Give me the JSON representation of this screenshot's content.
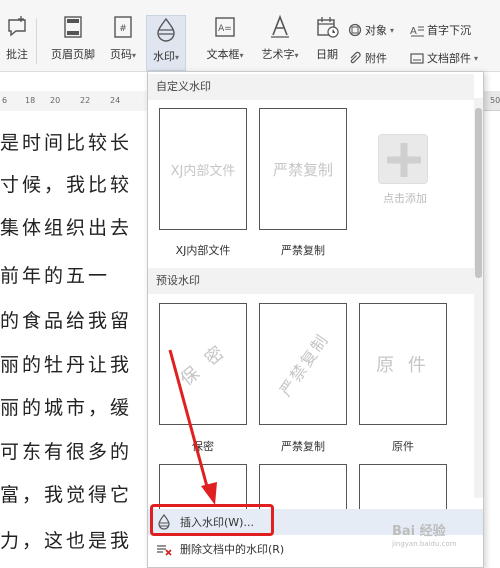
{
  "ribbon": {
    "buttons": [
      {
        "label": "批注",
        "icon": "comment-icon"
      },
      {
        "label": "页眉页脚",
        "icon": "header-footer-icon"
      },
      {
        "label": "页码",
        "icon": "page-number-icon"
      },
      {
        "label": "水印",
        "icon": "watermark-icon"
      },
      {
        "label": "文本框",
        "icon": "textbox-icon"
      },
      {
        "label": "艺术字",
        "icon": "wordart-icon"
      },
      {
        "label": "日期",
        "icon": "date-icon"
      }
    ],
    "small": {
      "object": "对象",
      "dropcap": "首字下沉",
      "attachment": "附件",
      "docparts": "文档部件"
    }
  },
  "ruler": {
    "numbers": [
      "6",
      "18",
      "20",
      "22",
      "24",
      "50"
    ]
  },
  "document": {
    "lines": [
      "是时间比较长",
      "寸候，我比较",
      "集体组织出去",
      "  前年的五一",
      "的食品给我留",
      "丽的牡丹让我",
      "丽的城市，缓",
      "可东有很多的",
      "富，我觉得它",
      "力，这也是我"
    ]
  },
  "dropdown": {
    "custom_header": "自定义水印",
    "custom": [
      {
        "text": "XJ内部文件",
        "caption": "XJ内部文件"
      },
      {
        "text": "严禁复制",
        "caption": "严禁复制"
      }
    ],
    "add_label": "点击添加",
    "preset_header": "预设水印",
    "preset": [
      {
        "text": "保 密",
        "caption": "保密"
      },
      {
        "text": "严禁复制",
        "caption": "严禁复制"
      },
      {
        "text": "原 件",
        "caption": "原件"
      }
    ],
    "menu": {
      "insert": "插入水印(W)...",
      "delete": "删除文档中的水印(R)"
    }
  },
  "site_logo": {
    "text": "Bai 经验",
    "sub": "jingyan.baidu.com"
  },
  "colors": {
    "highlight": "#e02020",
    "ribbon_bg": "#f6f6f6",
    "active_btn": "#dfe6f0"
  }
}
